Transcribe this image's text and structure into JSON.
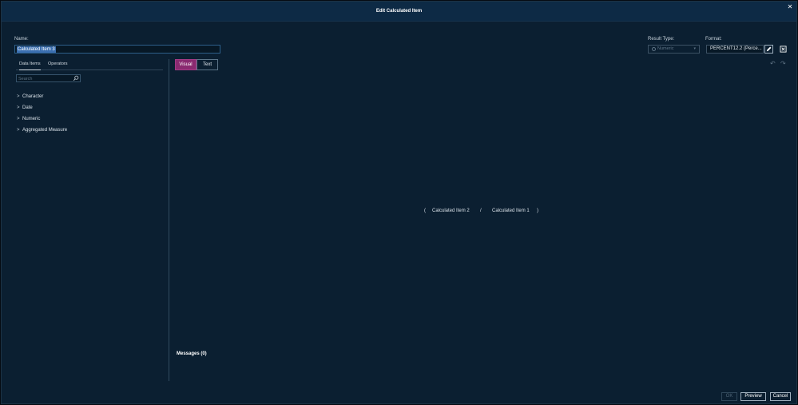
{
  "dialog": {
    "title": "Edit Calculated Item"
  },
  "name": {
    "label": "Name:",
    "value": "Calculated Item 3"
  },
  "left_panel": {
    "tabs": [
      {
        "label": "Data Items"
      },
      {
        "label": "Operators"
      }
    ],
    "search_placeholder": "Search",
    "tree": [
      {
        "label": "Character"
      },
      {
        "label": "Date"
      },
      {
        "label": "Numeric"
      },
      {
        "label": "Aggregated Measure"
      }
    ]
  },
  "editor": {
    "mode_visual": "Visual",
    "mode_text": "Text",
    "expression": {
      "open_paren": "(",
      "left_operand": "Calculated Item 2",
      "operator": "/",
      "right_operand": "Calculated Item 1",
      "close_paren": ")"
    },
    "messages_label": "Messages (0)"
  },
  "result_type": {
    "label": "Result Type:",
    "value": "Numeric"
  },
  "format": {
    "label": "Format:",
    "value": "PERCENT12.2 (Perce..."
  },
  "buttons": {
    "ok": "OK",
    "preview": "Preview",
    "cancel": "Cancel"
  },
  "colors": {
    "accent": "#8a2a70",
    "background": "#0b1f31",
    "titlebar": "#0d2a45",
    "selection": "#3b6fb0"
  }
}
